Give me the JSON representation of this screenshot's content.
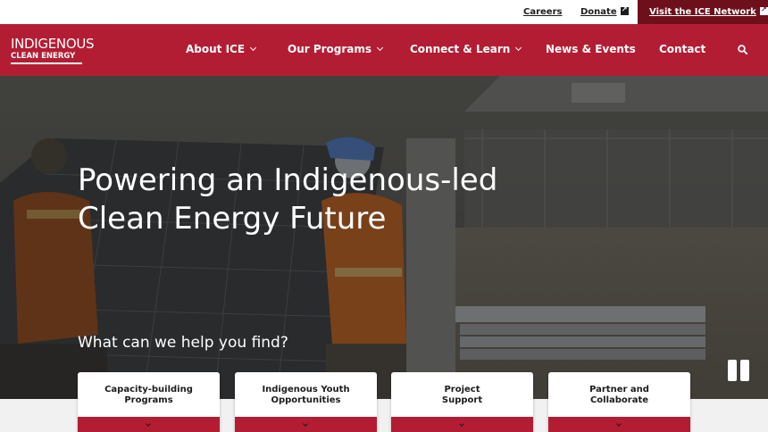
{
  "topbar": {
    "careers": "Careers",
    "donate": "Donate",
    "network": "Visit the ICE Network"
  },
  "brand": {
    "line1": "INDIGENOUS",
    "line2": "CLEAN ENERGY"
  },
  "nav": {
    "items": [
      {
        "label": "About ICE",
        "has_dropdown": true
      },
      {
        "label": "Our Programs",
        "has_dropdown": true
      },
      {
        "label": "Connect & Learn",
        "has_dropdown": true
      },
      {
        "label": "News & Events",
        "has_dropdown": false
      },
      {
        "label": "Contact",
        "has_dropdown": false
      }
    ],
    "search_icon": "search-icon"
  },
  "hero": {
    "headline": "Powering an Indigenous-led Clean Energy Future",
    "prompt": "What can we help you find?",
    "control_icon": "pause-icon"
  },
  "cards": [
    {
      "label": "Capacity-building\nPrograms"
    },
    {
      "label": "Indigenous Youth\nOpportunities"
    },
    {
      "label": "Project\nSupport"
    },
    {
      "label": "Partner and\nCollaborate"
    }
  ],
  "colors": {
    "brand_red": "#b31d33",
    "network_dark_red": "#6e0f1c",
    "topbar_bg": "#ffffff",
    "text_white": "#ffffff"
  }
}
